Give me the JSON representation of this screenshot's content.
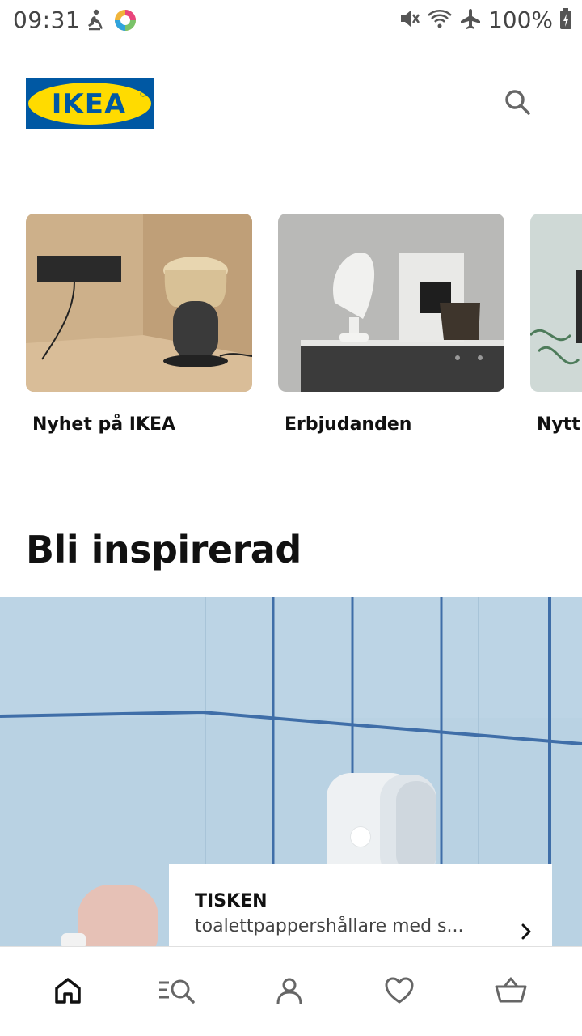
{
  "status_bar": {
    "time": "09:31",
    "battery": "100%",
    "icons": [
      "accessibility-icon",
      "app-icon",
      "mute-icon",
      "wifi-icon",
      "airplane-icon",
      "battery-charging-icon"
    ]
  },
  "header": {
    "logo_text": "IKEA",
    "search_icon": "search-icon"
  },
  "cards": [
    {
      "title": "Nyhet på IKEA"
    },
    {
      "title": "Erbjudanden"
    },
    {
      "title": "Nytt"
    }
  ],
  "section": {
    "title": "Bli inspirerad"
  },
  "hero": {
    "product_name": "TISKEN",
    "product_desc": "toalettpappershållare med s...",
    "next_icon": "chevron-right-icon"
  },
  "bottom_nav": {
    "items": [
      "home-icon",
      "browse-icon",
      "profile-icon",
      "favorites-icon",
      "cart-icon"
    ],
    "active": "home-icon"
  },
  "colors": {
    "ikea_blue": "#0058A3",
    "ikea_yellow": "#FFDB00",
    "hero_bg": "#B9D2E3"
  }
}
